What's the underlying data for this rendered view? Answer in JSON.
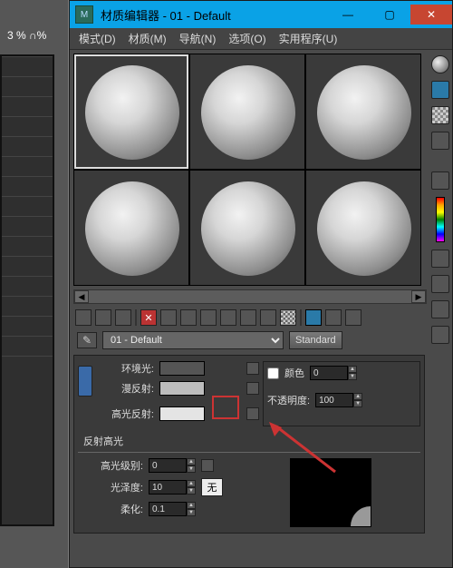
{
  "viewport_label": "3 % ∩%",
  "window": {
    "title": "材质编辑器 - 01 - Default"
  },
  "titlebar": {
    "min": "—",
    "max": "▢",
    "close": "✕"
  },
  "menus": {
    "mode": "模式(D)",
    "material": "材质(M)",
    "nav": "导航(N)",
    "options": "选项(O)",
    "util": "实用程序(U)"
  },
  "picker": {
    "name": "01 - Default",
    "type_button": "Standard"
  },
  "params": {
    "ambient": {
      "label": "环境光:"
    },
    "diffuse": {
      "label": "漫反射:"
    },
    "specular": {
      "label": "高光反射:"
    },
    "color_label": "颜色",
    "color_value": "0",
    "opacity_label": "不透明度:",
    "opacity_value": "100"
  },
  "highlights": {
    "title": "反射高光",
    "level_label": "高光级别:",
    "level_value": "0",
    "gloss_label": "光泽度:",
    "gloss_value": "10",
    "soften_label": "柔化:",
    "soften_value": "0.1",
    "none_button": "无"
  }
}
